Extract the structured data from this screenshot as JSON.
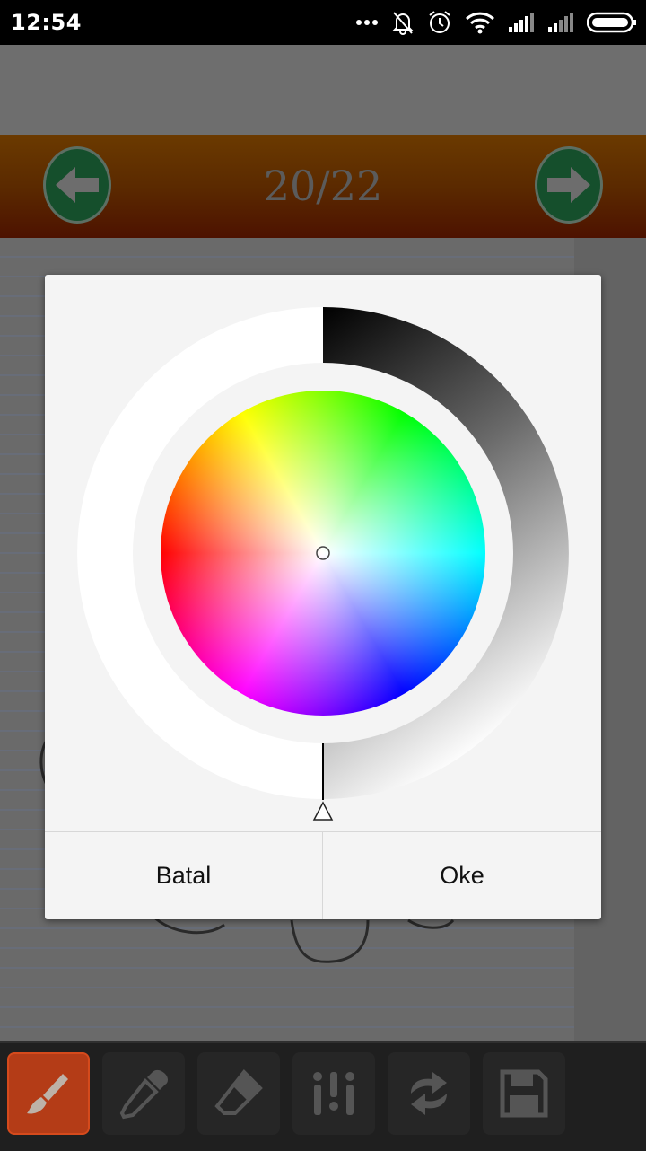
{
  "status_bar": {
    "time": "12:54",
    "icons": [
      "more-dots-icon",
      "bell-off-icon",
      "alarm-icon",
      "wifi-icon",
      "signal-icon",
      "signal-icon",
      "battery-icon"
    ]
  },
  "header": {
    "page_counter": "20/22",
    "prev_icon": "arrow-left-icon",
    "next_icon": "arrow-right-icon"
  },
  "color_picker": {
    "brightness_ring": "black-to-white gradient",
    "selected_color": "#ffffff",
    "wheel_colors": [
      "#ff0000",
      "#ffff00",
      "#00ff00",
      "#00ffff",
      "#0000ff",
      "#ff00ff"
    ]
  },
  "dialog": {
    "cancel_label": "Batal",
    "ok_label": "Oke"
  },
  "toolbar": {
    "tools": [
      {
        "icon": "brush-icon",
        "active": true
      },
      {
        "icon": "eyedropper-icon",
        "active": false
      },
      {
        "icon": "eraser-icon",
        "active": false
      },
      {
        "icon": "sliders-icon",
        "active": false
      },
      {
        "icon": "swap-icon",
        "active": false
      },
      {
        "icon": "save-icon",
        "active": false
      }
    ]
  },
  "colors": {
    "accent_active": "#b43c17",
    "nav_button": "#154f2c",
    "dialog_bg": "#f4f4f4"
  }
}
